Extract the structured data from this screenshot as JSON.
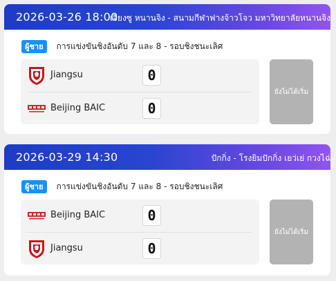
{
  "matches": [
    {
      "datetime": "2026-03-26 18:00",
      "venue": "เจียงซู หนานจิง - สนามกีฬาฟางจ้าวโจว มหาวิทยาลัยหนานจิง",
      "gender_badge": "ผู้ชาย",
      "round": "การแข่งขันชิงอันดับ 7 และ 8 - รอบชิงชนะเลิศ",
      "home": {
        "name": "Jiangsu",
        "score": "0",
        "logo_icon": "jiangsu-crest-icon"
      },
      "away": {
        "name": "Beijing BAIC",
        "score": "0",
        "logo_icon": "baic-logo-icon"
      },
      "status": "ยังไม่ได้เริ่ม"
    },
    {
      "datetime": "2026-03-29 14:30",
      "venue": "ปักกิ่ง - โรงยิมปักกิ่ง เยว่เย่ กวงไฉ่",
      "gender_badge": "ผู้ชาย",
      "round": "การแข่งขันชิงอันดับ 7 และ 8 - รอบชิงชนะเลิศ",
      "home": {
        "name": "Beijing BAIC",
        "score": "0",
        "logo_icon": "baic-logo-icon"
      },
      "away": {
        "name": "Jiangsu",
        "score": "0",
        "logo_icon": "jiangsu-crest-icon"
      },
      "status": "ยังไม่ได้เริ่ม"
    }
  ],
  "colors": {
    "header_start": "#1d3cc4",
    "header_end": "#9155f0",
    "badge": "#1890ff",
    "status_bg": "#b3b3b3",
    "jiangsu_red": "#c8161e",
    "baic_red": "#d42222"
  }
}
